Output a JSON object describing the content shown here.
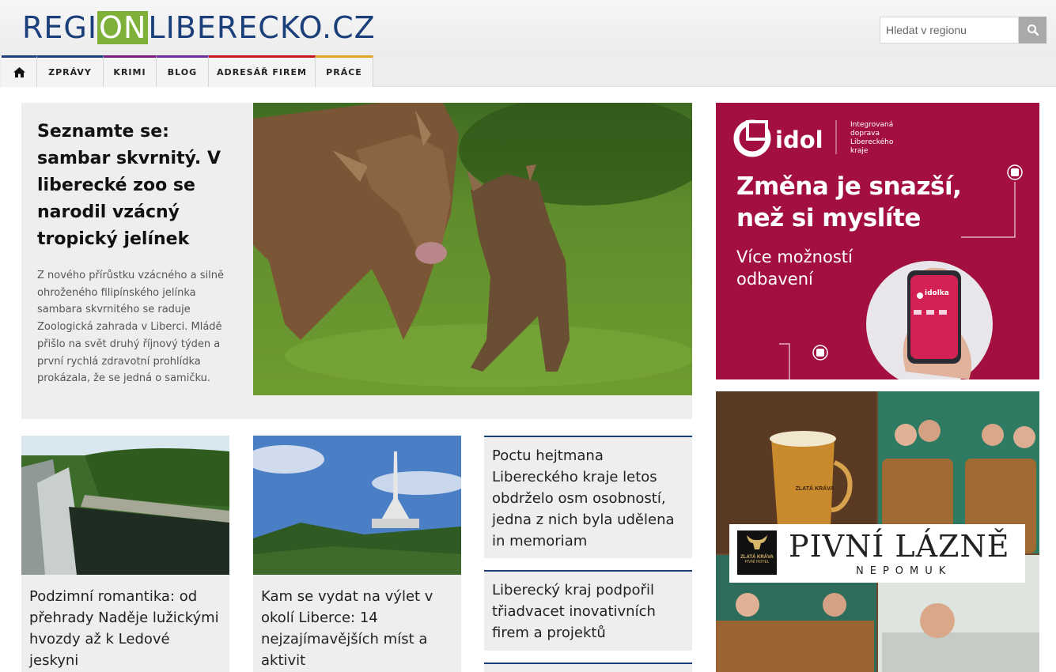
{
  "header": {
    "logo_parts": [
      "REGI",
      "ON",
      "LIBERECKO.CZ"
    ],
    "search_placeholder": "Hledat v regionu"
  },
  "nav": {
    "items": [
      {
        "label": "",
        "icon": "home-icon",
        "color": "#1b3f7a"
      },
      {
        "label": "ZPRÁVY",
        "color": "#1b3f7a"
      },
      {
        "label": "KRIMI",
        "color": "#7b1c7c"
      },
      {
        "label": "BLOG",
        "color": "#6d2fa0"
      },
      {
        "label": "ADRESÁŘ FIREM",
        "color": "#c8161d"
      },
      {
        "label": "PRÁCE",
        "color": "#e0a526"
      }
    ]
  },
  "feature": {
    "title": "Seznamte se: sambar skvrnitý. V liberecké zoo se narodil vzácný tropický jelínek",
    "text": "Z nového přírůstku vzácného a silně ohroženého filipínského jelínka sambara skvrnitého se raduje Zoologická zahrada v Liberci. Mládě přišlo na svět druhý říjnový týden a první rychlá zdravotní prohlídka prokázala, že se jedná o samičku."
  },
  "cards": [
    {
      "title": "Podzimní romantika: od přehrady Naděje lužickými hvozdy až k Ledové jeskyni"
    },
    {
      "title": "Kam se vydat na výlet v okolí Liberce: 14 nejzajímavějších míst a aktivit"
    }
  ],
  "news": [
    {
      "title": "Poctu hejtmana Libereckého kraje letos obdrželo osm osobností, jedna z nich byla udělena in memoriam"
    },
    {
      "title": "Liberecký kraj podpořil třiadvacet inovativních firem a projektů"
    }
  ],
  "ad_idol": {
    "brand": "idol",
    "brand_sub": "Integrovaná doprava Libereckého kraje",
    "headline_1": "Změna je snazší,",
    "headline_2": "než si myslíte",
    "sub_1": "Více možností",
    "sub_2": "odbavení",
    "app_name": "idolka",
    "bg_color": "#a3103f"
  },
  "ad_beer": {
    "title": "PIVNÍ LÁZNĚ",
    "subtitle": "NEPOMUK",
    "brand": "ZLATÁ KRÁVA",
    "brand_sub": "PIVNÍ HOTEL",
    "glass_label": "ZLATÁ KRÁVA"
  },
  "colors": {
    "brand_blue": "#1b3f7a",
    "brand_green": "#7fb13a"
  }
}
